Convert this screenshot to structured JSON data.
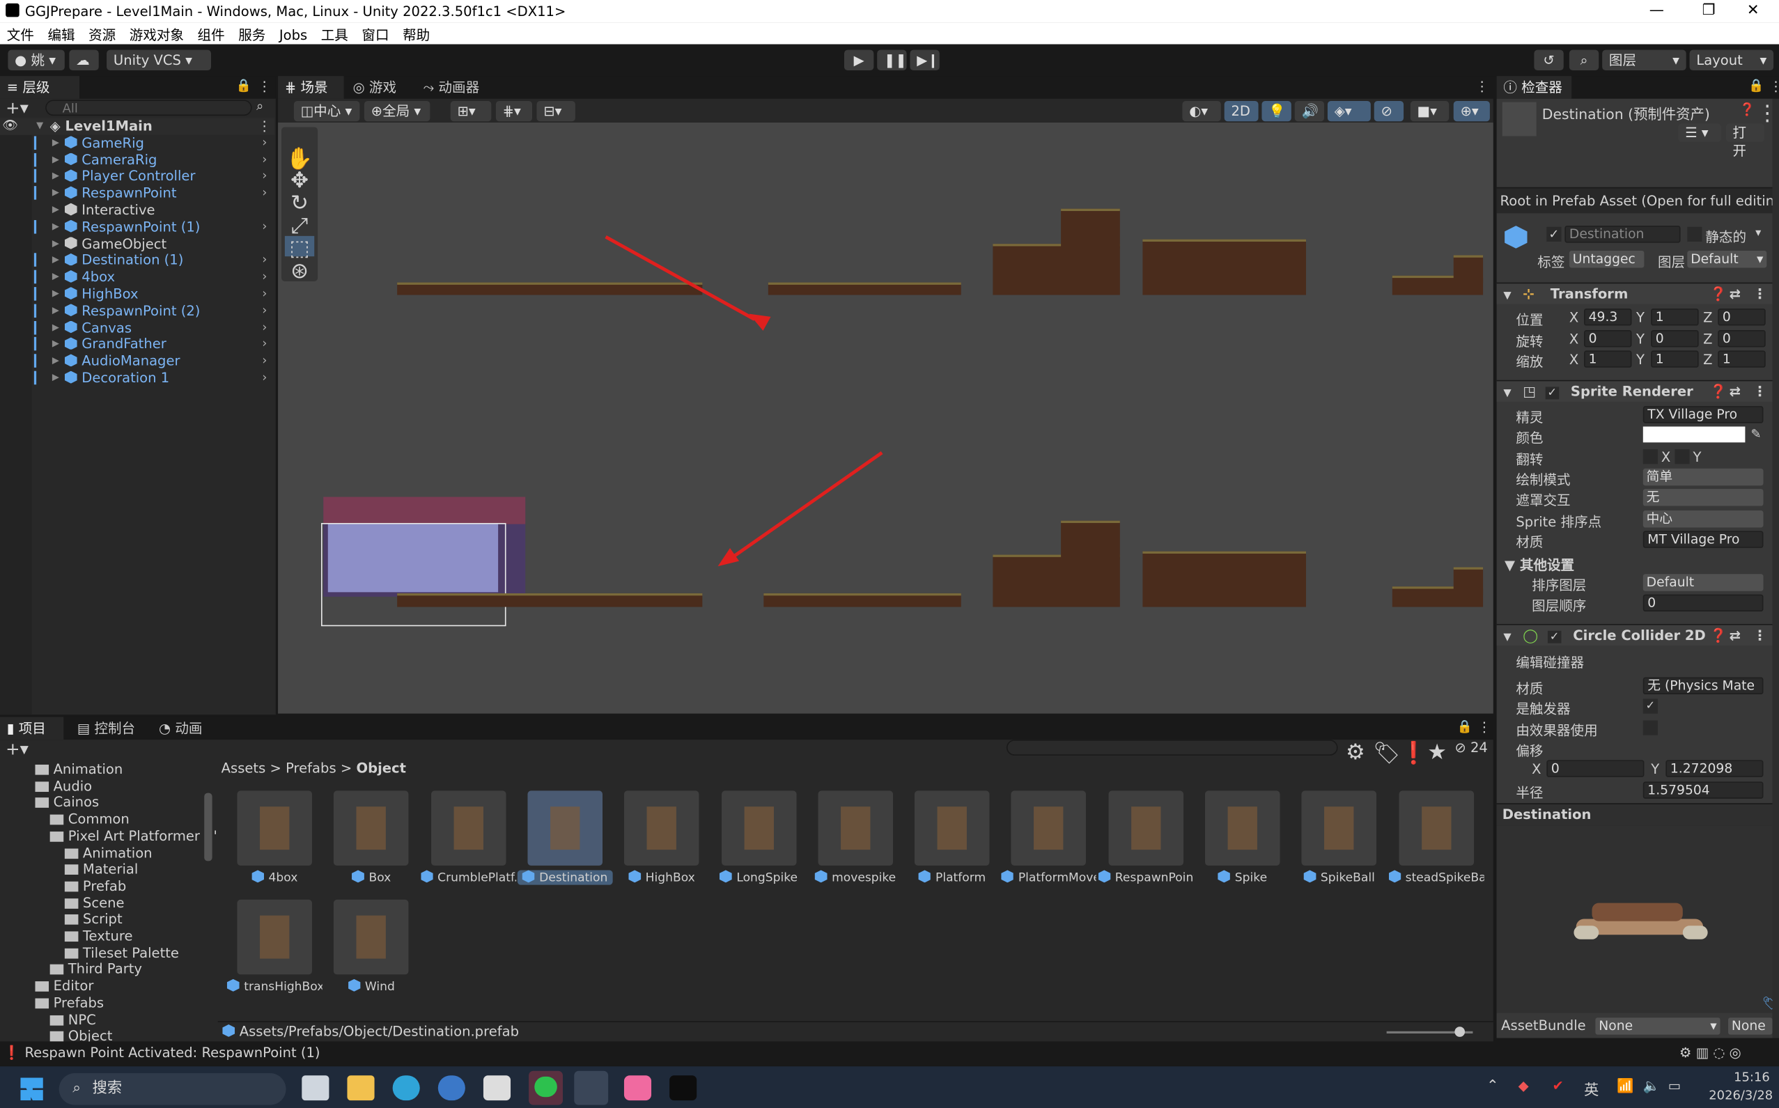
{
  "window": {
    "title": "GGJPrepare - Level1Main - Windows, Mac, Linux - Unity 2022.3.50f1c1 <DX11>",
    "minimize": "—",
    "maximize": "❐",
    "close": "✕"
  },
  "menu": [
    "文件",
    "编辑",
    "资源",
    "游戏对象",
    "组件",
    "服务",
    "Jobs",
    "工具",
    "窗口",
    "帮助"
  ],
  "toolbar": {
    "account": "姚",
    "vcs": "Unity VCS",
    "layers": "图层",
    "layout": "Layout"
  },
  "hierarchy": {
    "tab": "层级",
    "search_placeholder": "All",
    "scene": "Level1Main",
    "items": [
      {
        "label": "GameRig",
        "blue": true
      },
      {
        "label": "CameraRig",
        "blue": true
      },
      {
        "label": "Player Controller",
        "blue": true
      },
      {
        "label": "RespawnPoint",
        "blue": true
      },
      {
        "label": "Interactive",
        "blue": false
      },
      {
        "label": "RespawnPoint (1)",
        "blue": true
      },
      {
        "label": "GameObject",
        "blue": false
      },
      {
        "label": "Destination (1)",
        "blue": true
      },
      {
        "label": "4box",
        "blue": true
      },
      {
        "label": "HighBox",
        "blue": true
      },
      {
        "label": "RespawnPoint (2)",
        "blue": true
      },
      {
        "label": "Canvas",
        "blue": true
      },
      {
        "label": "GrandFather",
        "blue": true
      },
      {
        "label": "AudioManager",
        "blue": true
      },
      {
        "label": "Decoration 1",
        "blue": true
      }
    ]
  },
  "scene_tabs": {
    "scene": "场景",
    "game": "游戏",
    "animator": "动画器"
  },
  "scene_toolbar": {
    "pivot": "中心",
    "global": "全局",
    "mode2d": "2D"
  },
  "project": {
    "tabs": {
      "project": "项目",
      "console": "控制台",
      "animation": "动画"
    },
    "count": "24",
    "tree": [
      {
        "label": "Animation",
        "indent": 1
      },
      {
        "label": "Audio",
        "indent": 1
      },
      {
        "label": "Cainos",
        "indent": 1
      },
      {
        "label": "Common",
        "indent": 2
      },
      {
        "label": "Pixel Art Platformer - '",
        "indent": 2
      },
      {
        "label": "Animation",
        "indent": 3
      },
      {
        "label": "Material",
        "indent": 3
      },
      {
        "label": "Prefab",
        "indent": 3
      },
      {
        "label": "Scene",
        "indent": 3
      },
      {
        "label": "Script",
        "indent": 3
      },
      {
        "label": "Texture",
        "indent": 3
      },
      {
        "label": "Tileset Palette",
        "indent": 3
      },
      {
        "label": "Third Party",
        "indent": 2
      },
      {
        "label": "Editor",
        "indent": 1
      },
      {
        "label": "Prefabs",
        "indent": 1
      },
      {
        "label": "NPC",
        "indent": 2
      },
      {
        "label": "Object",
        "indent": 2
      }
    ],
    "breadcrumb": [
      "Assets",
      "Prefabs",
      "Object"
    ],
    "assets": [
      "4box",
      "Box",
      "CrumblePlatf...",
      "Destination",
      "HighBox",
      "LongSpike",
      "movespike",
      "Platform",
      "PlatformMove",
      "RespawnPoint",
      "Spike",
      "SpikeBall",
      "steadSpikeBa...",
      "transHighBox",
      "Wind"
    ],
    "path": "Assets/Prefabs/Object/Destination.prefab"
  },
  "status": "Respawn Point Activated: RespawnPoint (1)",
  "inspector": {
    "tab": "检查器",
    "asset_title": "Destination (预制件资产)",
    "open": "打开",
    "root_note": "Root in Prefab Asset (Open for full editing",
    "name": "Destination",
    "static": "静态的",
    "tag_label": "标签",
    "tag": "Untaggec",
    "layer_label": "图层",
    "layer": "Default",
    "transform": {
      "title": "Transform",
      "pos": "位置",
      "rot": "旋转",
      "scale": "缩放",
      "px": "49.3",
      "py": "1",
      "pz": "0",
      "rx": "0",
      "ry": "0",
      "rz": "0",
      "sx": "1",
      "sy": "1",
      "sz": "1"
    },
    "sprite": {
      "title": "Sprite Renderer",
      "sprite_label": "精灵",
      "sprite": "TX Village Pro",
      "color_label": "颜色",
      "flip_label": "翻转",
      "draw_label": "绘制模式",
      "draw": "简单",
      "mask_label": "遮罩交互",
      "mask": "无",
      "sort_label": "Sprite 排序点",
      "sort": "中心",
      "mat_label": "材质",
      "mat": "MT Village Pro",
      "other": "其他设置",
      "sortlayer_label": "排序图层",
      "sortlayer": "Default",
      "order_label": "图层顺序",
      "order": "0"
    },
    "collider": {
      "title": "Circle Collider 2D",
      "edit": "编辑碰撞器",
      "mat_label": "材质",
      "mat": "无 (Physics Mate",
      "trigger_label": "是触发器",
      "effector_label": "由效果器使用",
      "offset_label": "偏移",
      "ox": "0",
      "oy": "1.272098",
      "radius_label": "半径",
      "radius": "1.579504"
    },
    "preview_title": "Destination",
    "assetbundle_label": "AssetBundle",
    "assetbundle": "None",
    "variant": "None"
  },
  "taskbar": {
    "search": "搜索",
    "ime": "英",
    "time": "15:16",
    "date": "2026/3/28"
  },
  "colors": {
    "accent": "#62a9ef",
    "arrow": "#e0201e",
    "scene_bg": "#474747"
  }
}
